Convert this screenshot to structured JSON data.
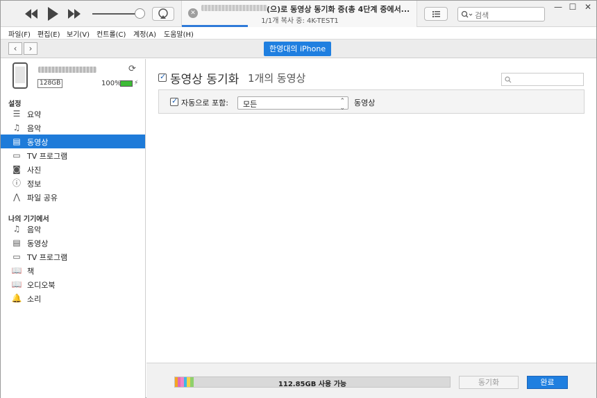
{
  "player": {
    "now_playing_line1": "(으)로 동영상 동기화 중(총 4단계 중에서...",
    "now_playing_line2": "1/1개 복사 중: 4K-TEST1",
    "close_symbol": "✕",
    "search_placeholder": "검색",
    "sync_progress_fraction": 0.28
  },
  "window_controls": {
    "minimize": "—",
    "maximize": "☐",
    "close": "✕"
  },
  "menu": [
    {
      "label": "파일(F)"
    },
    {
      "label": "편집(E)"
    },
    {
      "label": "보기(V)"
    },
    {
      "label": "컨트롤(C)"
    },
    {
      "label": "계정(A)"
    },
    {
      "label": "도움말(H)"
    }
  ],
  "navbar": {
    "back": "‹",
    "forward": "›",
    "device_name": "한영대의 iPhone"
  },
  "device": {
    "capacity": "128GB",
    "battery_percent": "100%",
    "battery_level": 1.0,
    "battery_color": "#3dbb36"
  },
  "sidebar": {
    "settings_title": "설정",
    "settings_items": [
      {
        "label": "요약",
        "icon": "summary-icon"
      },
      {
        "label": "음악",
        "icon": "music-icon"
      },
      {
        "label": "동영상",
        "icon": "movie-icon",
        "active": true
      },
      {
        "label": "TV 프로그램",
        "icon": "tv-icon"
      },
      {
        "label": "사진",
        "icon": "camera-icon"
      },
      {
        "label": "정보",
        "icon": "info-icon"
      },
      {
        "label": "파일 공유",
        "icon": "apps-icon"
      }
    ],
    "on_device_title": "나의 기기에서",
    "on_device_items": [
      {
        "label": "음악",
        "icon": "music-icon"
      },
      {
        "label": "동영상",
        "icon": "movie-icon"
      },
      {
        "label": "TV 프로그램",
        "icon": "tv-icon"
      },
      {
        "label": "책",
        "icon": "book-icon"
      },
      {
        "label": "오디오북",
        "icon": "audiobook-icon"
      },
      {
        "label": "소리",
        "icon": "bell-icon"
      }
    ]
  },
  "main": {
    "title": "동영상 동기화",
    "count": "1개의 동영상",
    "auto_include_label": "자동으로 포함:",
    "auto_include_value": "모든",
    "auto_include_suffix": "동영상"
  },
  "footer": {
    "storage_label": "112.85GB 사용 가능",
    "sync_button": "동기화",
    "done_button": "완료"
  },
  "colors": {
    "accent": "#1f7fe0",
    "sidebar_active": "#1e7bd9"
  }
}
